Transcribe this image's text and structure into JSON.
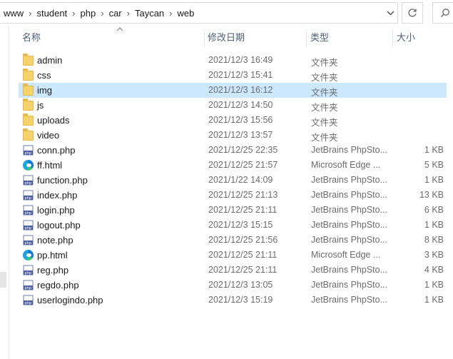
{
  "address": {
    "crumbs": [
      "www",
      "student",
      "php",
      "car",
      "Taycan",
      "web"
    ]
  },
  "columns": {
    "name": "名称",
    "date": "修改日期",
    "type": "类型",
    "size": "大小"
  },
  "files": [
    {
      "name": "admin",
      "date": "2021/12/3 16:49",
      "type": "文件夹",
      "size": "",
      "icon": "folder-icon"
    },
    {
      "name": "css",
      "date": "2021/12/3 15:41",
      "type": "文件夹",
      "size": "",
      "icon": "folder-icon"
    },
    {
      "name": "img",
      "date": "2021/12/3 16:12",
      "type": "文件夹",
      "size": "",
      "icon": "folder-icon",
      "selected": true
    },
    {
      "name": "js",
      "date": "2021/12/3 14:50",
      "type": "文件夹",
      "size": "",
      "icon": "folder-icon"
    },
    {
      "name": "uploads",
      "date": "2021/12/3 15:56",
      "type": "文件夹",
      "size": "",
      "icon": "folder-icon"
    },
    {
      "name": "video",
      "date": "2021/12/3 13:57",
      "type": "文件夹",
      "size": "",
      "icon": "folder-icon"
    },
    {
      "name": "conn.php",
      "date": "2021/12/25 22:35",
      "type": "JetBrains PhpSto...",
      "size": "1 KB",
      "icon": "php-file-icon"
    },
    {
      "name": "ff.html",
      "date": "2021/12/25 21:57",
      "type": "Microsoft Edge ...",
      "size": "5 KB",
      "icon": "edge-html-icon"
    },
    {
      "name": "function.php",
      "date": "2021/1/22 14:09",
      "type": "JetBrains PhpSto...",
      "size": "1 KB",
      "icon": "php-file-icon"
    },
    {
      "name": "index.php",
      "date": "2021/12/25 21:13",
      "type": "JetBrains PhpSto...",
      "size": "13 KB",
      "icon": "php-file-icon"
    },
    {
      "name": "login.php",
      "date": "2021/12/25 21:11",
      "type": "JetBrains PhpSto...",
      "size": "6 KB",
      "icon": "php-file-icon"
    },
    {
      "name": "logout.php",
      "date": "2021/12/3 15:15",
      "type": "JetBrains PhpSto...",
      "size": "1 KB",
      "icon": "php-file-icon"
    },
    {
      "name": "note.php",
      "date": "2021/12/25 21:56",
      "type": "JetBrains PhpSto...",
      "size": "8 KB",
      "icon": "php-file-icon"
    },
    {
      "name": "pp.html",
      "date": "2021/12/25 21:11",
      "type": "Microsoft Edge ...",
      "size": "3 KB",
      "icon": "edge-html-icon"
    },
    {
      "name": "reg.php",
      "date": "2021/12/25 21:11",
      "type": "JetBrains PhpSto...",
      "size": "4 KB",
      "icon": "php-file-icon"
    },
    {
      "name": "regdo.php",
      "date": "2021/12/3 13:05",
      "type": "JetBrains PhpSto...",
      "size": "1 KB",
      "icon": "php-file-icon"
    },
    {
      "name": "userlogindo.php",
      "date": "2021/12/3 15:19",
      "type": "JetBrains PhpSto...",
      "size": "1 KB",
      "icon": "php-file-icon"
    }
  ],
  "colors": {
    "selection": "#cce8ff",
    "folder": "#f6d26b",
    "header_text": "#4c607a"
  }
}
